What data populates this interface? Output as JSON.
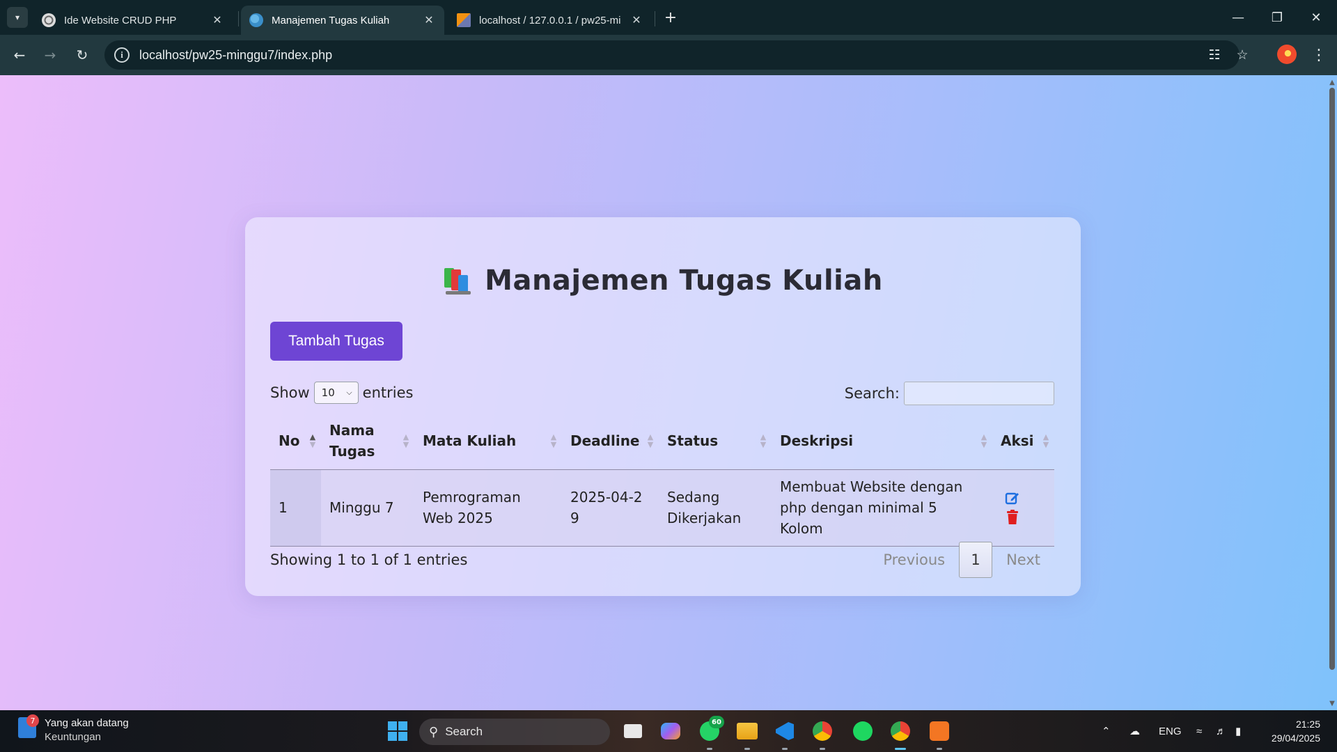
{
  "browser": {
    "tabs": [
      {
        "title": "Ide Website CRUD PHP",
        "active": false
      },
      {
        "title": "Manajemen Tugas Kuliah",
        "active": true
      },
      {
        "title": "localhost / 127.0.0.1 / pw25-mi",
        "active": false
      }
    ],
    "url": "localhost/pw25-minggu7/index.php"
  },
  "page": {
    "title": "Manajemen Tugas Kuliah",
    "add_button": "Tambah Tugas",
    "length": {
      "show": "Show",
      "value": "10",
      "entries": "entries"
    },
    "search_label": "Search:",
    "columns": [
      "No",
      "Nama Tugas",
      "Mata Kuliah",
      "Deadline",
      "Status",
      "Deskripsi",
      "Aksi"
    ],
    "rows": [
      {
        "no": "1",
        "nama": "Minggu 7",
        "mata_kuliah": "Pemrograman Web 2025",
        "deadline": "2025-04-29",
        "status": "Sedang Dikerjakan",
        "deskripsi": "Membuat Website dengan php dengan minimal 5 Kolom"
      }
    ],
    "info": "Showing 1 to 1 of 1 entries",
    "pagination": {
      "previous": "Previous",
      "current": "1",
      "next": "Next"
    }
  },
  "taskbar": {
    "widget": {
      "badge": "7",
      "line1": "Yang akan datang",
      "line2": "Keuntungan"
    },
    "search": "Search",
    "whatsapp_badge": "60",
    "tray_lang": "ENG",
    "time": "21:25",
    "date": "29/04/2025"
  },
  "colors": {
    "accent_button": "#6e45d4",
    "edit_icon": "#1e6fe0",
    "delete_icon": "#e01f1f"
  },
  "icons": [
    "tab-search-icon",
    "chrome-icon",
    "globe-icon",
    "phpmyadmin-icon",
    "back-icon",
    "forward-icon",
    "reload-icon",
    "info-icon",
    "translate-icon",
    "star-icon",
    "books-icon",
    "edit-icon",
    "trash-icon",
    "windows-start-icon",
    "search-icon"
  ]
}
